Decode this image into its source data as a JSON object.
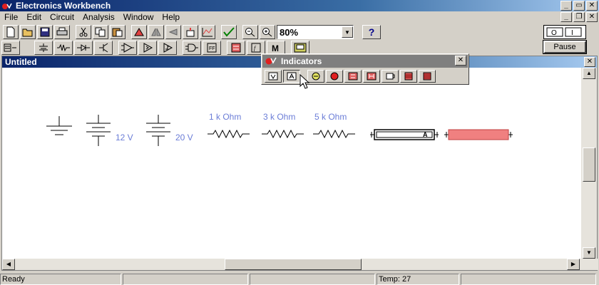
{
  "app": {
    "title": "Electronics Workbench"
  },
  "menu": [
    "File",
    "Edit",
    "Circuit",
    "Analysis",
    "Window",
    "Help"
  ],
  "toolbar": {
    "zoom": "80%",
    "help": "?"
  },
  "simulation": {
    "pause_label": "Pause"
  },
  "document": {
    "title": "Untitled"
  },
  "palette": {
    "title": "Indicators"
  },
  "circuit": {
    "battery1": "12 V",
    "battery2": "20 V",
    "resistor1": "1 k Ohm",
    "resistor2": "3 k Ohm",
    "resistor3": "5 k Ohm",
    "ammeter_mark": "A"
  },
  "status": {
    "ready": "Ready",
    "temp": "Temp:  27"
  },
  "colors": {
    "title_bar": "#0a246a",
    "label_blue": "#6b7dd7",
    "bar_red": "#f08080"
  }
}
